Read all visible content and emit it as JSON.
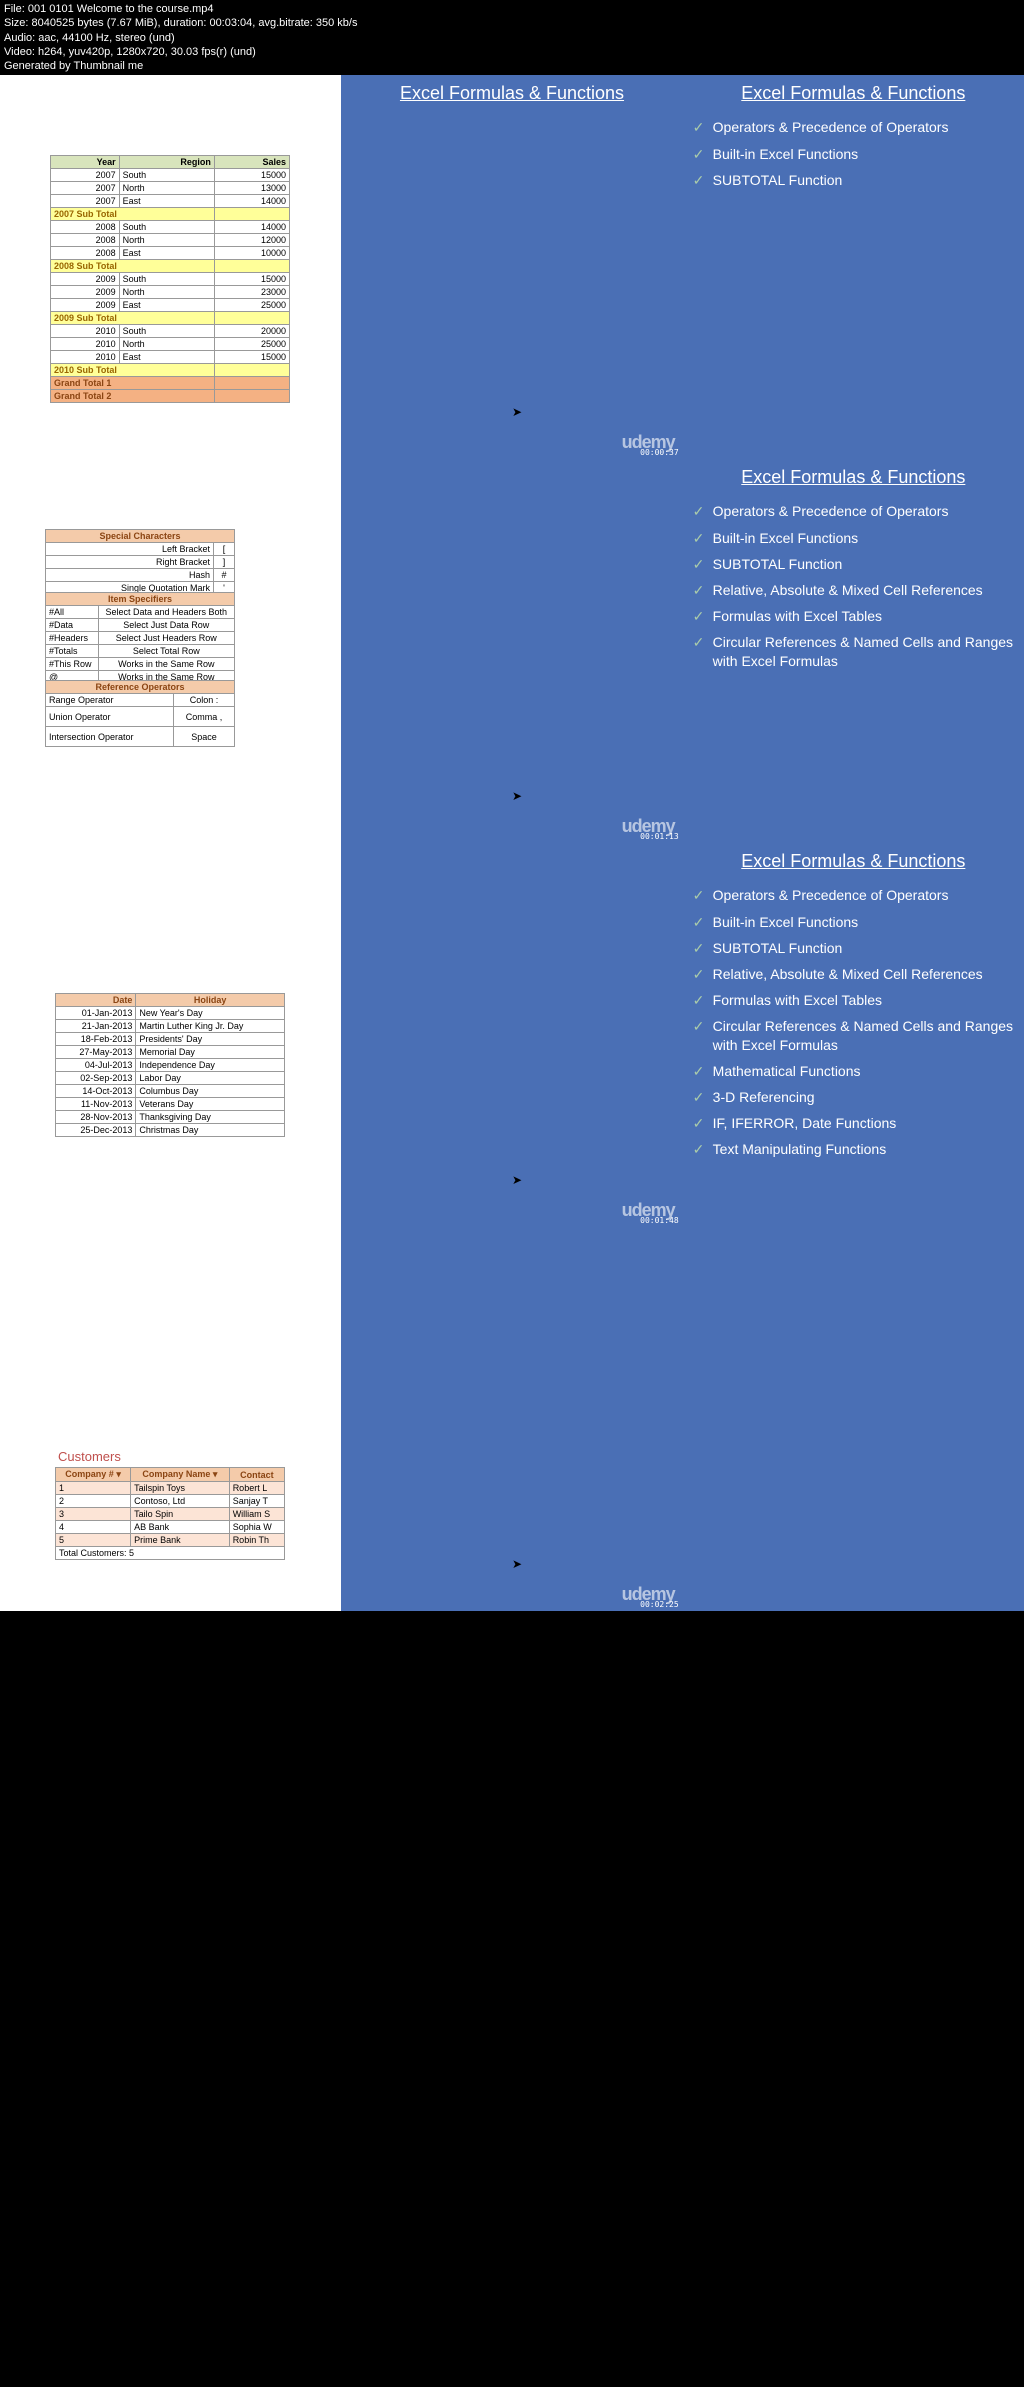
{
  "meta": {
    "l1": "File: 001 0101 Welcome to the course.mp4",
    "l2": "Size: 8040525 bytes (7.67 MiB), duration: 00:03:04, avg.bitrate: 350 kb/s",
    "l3": "Audio: aac, 44100 Hz, stereo (und)",
    "l4": "Video: h264, yuv420p, 1280x720, 30.03 fps(r) (und)",
    "l5": "Generated by Thumbnail me"
  },
  "slide_title": "Excel Formulas & Functions",
  "watermark": "udemy",
  "timestamps": {
    "t1": "00:00:37",
    "t2": "00:01:13",
    "t3": "00:01:48",
    "t4": "00:02:25"
  },
  "thumb1_table": {
    "headers": [
      "Year",
      "Region",
      "Sales"
    ],
    "rows": [
      [
        "2007",
        "South",
        "15000"
      ],
      [
        "2007",
        "North",
        "13000"
      ],
      [
        "2007",
        "East",
        "14000"
      ]
    ],
    "sub1": "2007 Sub Total",
    "rows2": [
      [
        "2008",
        "South",
        "14000"
      ],
      [
        "2008",
        "North",
        "12000"
      ],
      [
        "2008",
        "East",
        "10000"
      ]
    ],
    "sub2": "2008 Sub Total",
    "rows3": [
      [
        "2009",
        "South",
        "15000"
      ],
      [
        "2009",
        "North",
        "23000"
      ],
      [
        "2009",
        "East",
        "25000"
      ]
    ],
    "sub3": "2009 Sub Total",
    "rows4": [
      [
        "2010",
        "South",
        "20000"
      ],
      [
        "2010",
        "North",
        "25000"
      ],
      [
        "2010",
        "East",
        "15000"
      ]
    ],
    "sub4": "2010 Sub Total",
    "grand1": "Grand Total 1",
    "grand2": "Grand Total 2"
  },
  "slide2_list": [
    "Operators & Precedence of Operators",
    "Built-in Excel Functions",
    "SUBTOTAL Function"
  ],
  "thumb3_tables": {
    "t1_header": "Special Characters",
    "t1_rows": [
      [
        "Left Bracket",
        "["
      ],
      [
        "Right Bracket",
        "]"
      ],
      [
        "Hash",
        "#"
      ],
      [
        "Single Quotation Mark",
        "'"
      ]
    ],
    "t2_header": "Item Specifiers",
    "t2_rows": [
      [
        "#All",
        "Select Data and Headers Both"
      ],
      [
        "#Data",
        "Select Just Data Row"
      ],
      [
        "#Headers",
        "Select Just Headers Row"
      ],
      [
        "#Totals",
        "Select Total Row"
      ],
      [
        "#This Row",
        "Works in the Same Row"
      ],
      [
        "@",
        "Works in the Same Row"
      ]
    ],
    "t3_header": "Reference Operators",
    "t3_rows": [
      [
        "Range Operator",
        "Colon :"
      ],
      [
        "Union Operator",
        "Comma ,"
      ],
      [
        "Intersection Operator",
        "Space"
      ]
    ]
  },
  "slide3_list": [
    "Operators & Precedence of Operators",
    "Built-in Excel Functions",
    "SUBTOTAL Function",
    "Relative, Absolute & Mixed Cell References",
    "Formulas with Excel Tables",
    "Circular References & Named Cells and Ranges with Excel Formulas"
  ],
  "thumb5_table": {
    "headers": [
      "Date",
      "Holiday"
    ],
    "rows": [
      [
        "01-Jan-2013",
        "New Year's Day"
      ],
      [
        "21-Jan-2013",
        "Martin Luther King Jr. Day"
      ],
      [
        "18-Feb-2013",
        "Presidents' Day"
      ],
      [
        "27-May-2013",
        "Memorial Day"
      ],
      [
        "04-Jul-2013",
        "Independence Day"
      ],
      [
        "02-Sep-2013",
        "Labor Day"
      ],
      [
        "14-Oct-2013",
        "Columbus Day"
      ],
      [
        "11-Nov-2013",
        "Veterans Day"
      ],
      [
        "28-Nov-2013",
        "Thanksgiving Day"
      ],
      [
        "25-Dec-2013",
        "Christmas Day"
      ]
    ]
  },
  "slide4_list": [
    "Operators & Precedence of Operators",
    "Built-in Excel Functions",
    "SUBTOTAL Function",
    "Relative, Absolute & Mixed Cell References",
    "Formulas with Excel Tables",
    "Circular References & Named Cells and Ranges with Excel Formulas",
    "Mathematical Functions",
    "3-D Referencing",
    "IF, IFERROR, Date Functions",
    "Text Manipulating Functions"
  ],
  "thumb7": {
    "title": "Customers",
    "headers": [
      "Company #",
      "Company Name",
      "Contact"
    ],
    "rows": [
      [
        "1",
        "Tailspin Toys",
        "Robert L"
      ],
      [
        "2",
        "Contoso, Ltd",
        "Sanjay T"
      ],
      [
        "3",
        "Tailo Spin",
        "William S"
      ],
      [
        "4",
        "AB Bank",
        "Sophia W"
      ],
      [
        "5",
        "Prime Bank",
        "Robin Th"
      ]
    ],
    "footer": "Total Customers: 5"
  },
  "dropdown_icon": "▾"
}
